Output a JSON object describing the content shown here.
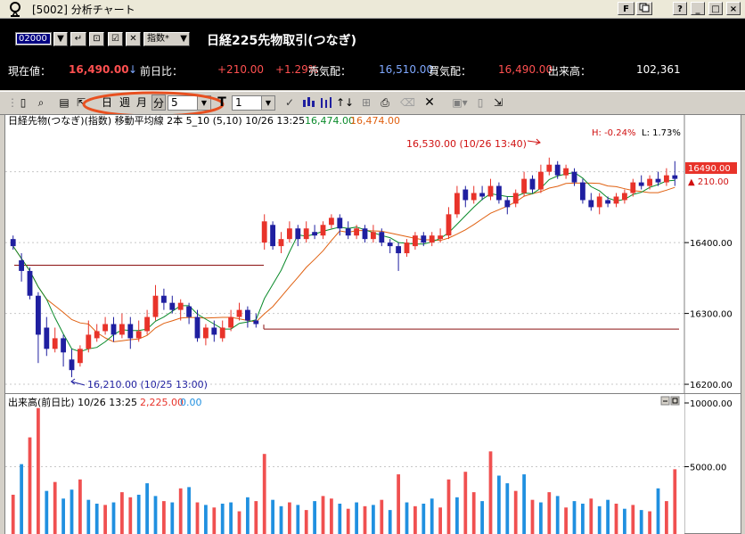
{
  "window": {
    "title": "[5002] 分析チャート",
    "buttons": [
      "F",
      "?",
      "_",
      "□",
      "×"
    ]
  },
  "header": {
    "code_value": "02000",
    "indicator_select": "指数*",
    "instrument_title": "日経225先物取引(つなぎ)",
    "current_price_label": "現在値：",
    "current_price": "16,490.00",
    "current_price_arrow": "↓",
    "prev_day_label": "前日比：",
    "change_value": "+210.00",
    "change_percent": "+1.29%",
    "ask_label": "売気配：",
    "ask_value": "16,510.00",
    "bid_label": "買気配：",
    "bid_value": "16,490.00",
    "volume_label": "出来高：",
    "volume_value": "102,361"
  },
  "toolbar": {
    "period_day": "日",
    "period_week": "週",
    "period_month": "月",
    "period_minute": "分",
    "minute_value": "5",
    "count_value": "1",
    "bold_t": "T"
  },
  "price_panel": {
    "legend_prefix": "日経先物(つなぎ)(指数) 移動平均線 2本 5_10 (5,10) 10/26 13:25 ",
    "legend_ma5": "16,474.00",
    "legend_ma10": "16,474.00",
    "high_annotation": "16,530.00 (10/26 13:40)",
    "low_annotation": "16,210.00 (10/25 13:00)",
    "h_label": "H: -0.24%",
    "l_label": "L: 1.73%",
    "last_price_tag": "16490.00",
    "change_tag": "▲ 210.00",
    "y_ticks": [
      "16400.00",
      "16300.00",
      "16200.00"
    ]
  },
  "volume_panel": {
    "legend_prefix": "出来高(前日比) 10/26 13:25 ",
    "legend_red": "2,225.00",
    "legend_blue": "0.00",
    "y_ticks": [
      "10000.00",
      "5000.00"
    ]
  },
  "chart_data": {
    "type": "candlestick",
    "ylim": [
      16190,
      16560
    ],
    "candles": [
      {
        "o": 16405,
        "c": 16395,
        "h": 16410,
        "l": 16390
      },
      {
        "o": 16375,
        "c": 16360,
        "h": 16385,
        "l": 16345
      },
      {
        "o": 16360,
        "c": 16325,
        "h": 16365,
        "l": 16320
      },
      {
        "o": 16325,
        "c": 16270,
        "h": 16330,
        "l": 16230
      },
      {
        "o": 16280,
        "c": 16250,
        "h": 16295,
        "l": 16240
      },
      {
        "o": 16250,
        "c": 16265,
        "h": 16280,
        "l": 16245
      },
      {
        "o": 16265,
        "c": 16245,
        "h": 16270,
        "l": 16225
      },
      {
        "o": 16235,
        "c": 16220,
        "h": 16250,
        "l": 16210
      },
      {
        "o": 16230,
        "c": 16250,
        "h": 16255,
        "l": 16225
      },
      {
        "o": 16250,
        "c": 16270,
        "h": 16290,
        "l": 16245
      },
      {
        "o": 16265,
        "c": 16275,
        "h": 16285,
        "l": 16260
      },
      {
        "o": 16275,
        "c": 16285,
        "h": 16295,
        "l": 16270
      },
      {
        "o": 16285,
        "c": 16270,
        "h": 16295,
        "l": 16260
      },
      {
        "o": 16270,
        "c": 16285,
        "h": 16300,
        "l": 16265
      },
      {
        "o": 16285,
        "c": 16265,
        "h": 16295,
        "l": 16250
      },
      {
        "o": 16265,
        "c": 16275,
        "h": 16290,
        "l": 16260
      },
      {
        "o": 16275,
        "c": 16295,
        "h": 16305,
        "l": 16270
      },
      {
        "o": 16295,
        "c": 16325,
        "h": 16340,
        "l": 16290
      },
      {
        "o": 16325,
        "c": 16315,
        "h": 16335,
        "l": 16305
      },
      {
        "o": 16315,
        "c": 16305,
        "h": 16325,
        "l": 16300
      },
      {
        "o": 16305,
        "c": 16315,
        "h": 16320,
        "l": 16290
      },
      {
        "o": 16310,
        "c": 16295,
        "h": 16315,
        "l": 16285
      },
      {
        "o": 16295,
        "c": 16265,
        "h": 16305,
        "l": 16260
      },
      {
        "o": 16265,
        "c": 16280,
        "h": 16285,
        "l": 16255
      },
      {
        "o": 16280,
        "c": 16270,
        "h": 16290,
        "l": 16260
      },
      {
        "o": 16265,
        "c": 16280,
        "h": 16290,
        "l": 16260
      },
      {
        "o": 16280,
        "c": 16295,
        "h": 16305,
        "l": 16275
      },
      {
        "o": 16295,
        "c": 16305,
        "h": 16315,
        "l": 16290
      },
      {
        "o": 16305,
        "c": 16290,
        "h": 16310,
        "l": 16280
      },
      {
        "o": 16290,
        "c": 16285,
        "h": 16300,
        "l": 16280
      },
      {
        "o": 16400,
        "c": 16430,
        "h": 16440,
        "l": 16390
      },
      {
        "o": 16425,
        "c": 16395,
        "h": 16430,
        "l": 16390
      },
      {
        "o": 16395,
        "c": 16405,
        "h": 16415,
        "l": 16385
      },
      {
        "o": 16405,
        "c": 16420,
        "h": 16430,
        "l": 16400
      },
      {
        "o": 16420,
        "c": 16405,
        "h": 16425,
        "l": 16395
      },
      {
        "o": 16405,
        "c": 16420,
        "h": 16430,
        "l": 16400
      },
      {
        "o": 16415,
        "c": 16410,
        "h": 16425,
        "l": 16405
      },
      {
        "o": 16410,
        "c": 16425,
        "h": 16430,
        "l": 16405
      },
      {
        "o": 16425,
        "c": 16435,
        "h": 16440,
        "l": 16420
      },
      {
        "o": 16435,
        "c": 16420,
        "h": 16440,
        "l": 16410
      },
      {
        "o": 16420,
        "c": 16410,
        "h": 16430,
        "l": 16405
      },
      {
        "o": 16410,
        "c": 16420,
        "h": 16425,
        "l": 16405
      },
      {
        "o": 16420,
        "c": 16405,
        "h": 16425,
        "l": 16400
      },
      {
        "o": 16405,
        "c": 16415,
        "h": 16425,
        "l": 16400
      },
      {
        "o": 16415,
        "c": 16400,
        "h": 16420,
        "l": 16395
      },
      {
        "o": 16400,
        "c": 16395,
        "h": 16405,
        "l": 16385
      },
      {
        "o": 16395,
        "c": 16385,
        "h": 16400,
        "l": 16360
      },
      {
        "o": 16385,
        "c": 16400,
        "h": 16405,
        "l": 16380
      },
      {
        "o": 16395,
        "c": 16410,
        "h": 16415,
        "l": 16390
      },
      {
        "o": 16410,
        "c": 16400,
        "h": 16415,
        "l": 16395
      },
      {
        "o": 16400,
        "c": 16410,
        "h": 16415,
        "l": 16395
      },
      {
        "o": 16405,
        "c": 16410,
        "h": 16420,
        "l": 16400
      },
      {
        "o": 16410,
        "c": 16440,
        "h": 16450,
        "l": 16405
      },
      {
        "o": 16440,
        "c": 16470,
        "h": 16480,
        "l": 16435
      },
      {
        "o": 16475,
        "c": 16460,
        "h": 16480,
        "l": 16450
      },
      {
        "o": 16460,
        "c": 16470,
        "h": 16480,
        "l": 16455
      },
      {
        "o": 16470,
        "c": 16465,
        "h": 16480,
        "l": 16460
      },
      {
        "o": 16465,
        "c": 16480,
        "h": 16490,
        "l": 16460
      },
      {
        "o": 16480,
        "c": 16460,
        "h": 16485,
        "l": 16455
      },
      {
        "o": 16460,
        "c": 16450,
        "h": 16465,
        "l": 16440
      },
      {
        "o": 16455,
        "c": 16470,
        "h": 16475,
        "l": 16450
      },
      {
        "o": 16470,
        "c": 16490,
        "h": 16500,
        "l": 16465
      },
      {
        "o": 16490,
        "c": 16475,
        "h": 16495,
        "l": 16470
      },
      {
        "o": 16475,
        "c": 16500,
        "h": 16510,
        "l": 16470
      },
      {
        "o": 16500,
        "c": 16510,
        "h": 16520,
        "l": 16495
      },
      {
        "o": 16510,
        "c": 16495,
        "h": 16515,
        "l": 16490
      },
      {
        "o": 16495,
        "c": 16505,
        "h": 16510,
        "l": 16490
      },
      {
        "o": 16500,
        "c": 16485,
        "h": 16505,
        "l": 16480
      },
      {
        "o": 16485,
        "c": 16460,
        "h": 16490,
        "l": 16455
      },
      {
        "o": 16460,
        "c": 16450,
        "h": 16470,
        "l": 16445
      },
      {
        "o": 16450,
        "c": 16465,
        "h": 16470,
        "l": 16440
      },
      {
        "o": 16460,
        "c": 16455,
        "h": 16465,
        "l": 16450
      },
      {
        "o": 16455,
        "c": 16465,
        "h": 16470,
        "l": 16450
      },
      {
        "o": 16460,
        "c": 16470,
        "h": 16475,
        "l": 16455
      },
      {
        "o": 16470,
        "c": 16485,
        "h": 16490,
        "l": 16465
      },
      {
        "o": 16485,
        "c": 16480,
        "h": 16495,
        "l": 16475
      },
      {
        "o": 16480,
        "c": 16490,
        "h": 16495,
        "l": 16475
      },
      {
        "o": 16490,
        "c": 16485,
        "h": 16500,
        "l": 16480
      },
      {
        "o": 16485,
        "c": 16495,
        "h": 16505,
        "l": 16480
      },
      {
        "o": 16495,
        "c": 16490,
        "h": 16515,
        "l": 16480
      }
    ],
    "hline_upper": 16368,
    "hline_lower": 16278,
    "volume_ylim": [
      0,
      10000
    ],
    "volume": [
      {
        "v": 2800,
        "d": "u"
      },
      {
        "v": 5200,
        "d": "d"
      },
      {
        "v": 7300,
        "d": "u"
      },
      {
        "v": 9600,
        "d": "u"
      },
      {
        "v": 3100,
        "d": "d"
      },
      {
        "v": 3800,
        "d": "u"
      },
      {
        "v": 2500,
        "d": "d"
      },
      {
        "v": 3200,
        "d": "d"
      },
      {
        "v": 4000,
        "d": "u"
      },
      {
        "v": 2400,
        "d": "d"
      },
      {
        "v": 2100,
        "d": "d"
      },
      {
        "v": 2000,
        "d": "u"
      },
      {
        "v": 2200,
        "d": "d"
      },
      {
        "v": 3000,
        "d": "u"
      },
      {
        "v": 2600,
        "d": "u"
      },
      {
        "v": 2800,
        "d": "d"
      },
      {
        "v": 3700,
        "d": "d"
      },
      {
        "v": 2700,
        "d": "d"
      },
      {
        "v": 2300,
        "d": "u"
      },
      {
        "v": 2200,
        "d": "d"
      },
      {
        "v": 3300,
        "d": "u"
      },
      {
        "v": 3400,
        "d": "d"
      },
      {
        "v": 2200,
        "d": "u"
      },
      {
        "v": 2000,
        "d": "d"
      },
      {
        "v": 1800,
        "d": "u"
      },
      {
        "v": 2100,
        "d": "d"
      },
      {
        "v": 2200,
        "d": "d"
      },
      {
        "v": 1500,
        "d": "u"
      },
      {
        "v": 2600,
        "d": "d"
      },
      {
        "v": 2300,
        "d": "u"
      },
      {
        "v": 6000,
        "d": "u"
      },
      {
        "v": 2400,
        "d": "d"
      },
      {
        "v": 1900,
        "d": "d"
      },
      {
        "v": 2200,
        "d": "u"
      },
      {
        "v": 2000,
        "d": "d"
      },
      {
        "v": 1600,
        "d": "u"
      },
      {
        "v": 2300,
        "d": "d"
      },
      {
        "v": 2700,
        "d": "u"
      },
      {
        "v": 2500,
        "d": "u"
      },
      {
        "v": 2100,
        "d": "d"
      },
      {
        "v": 1700,
        "d": "u"
      },
      {
        "v": 2200,
        "d": "d"
      },
      {
        "v": 1900,
        "d": "u"
      },
      {
        "v": 2000,
        "d": "d"
      },
      {
        "v": 2400,
        "d": "u"
      },
      {
        "v": 1600,
        "d": "d"
      },
      {
        "v": 4400,
        "d": "u"
      },
      {
        "v": 2200,
        "d": "d"
      },
      {
        "v": 1900,
        "d": "u"
      },
      {
        "v": 2100,
        "d": "d"
      },
      {
        "v": 2500,
        "d": "d"
      },
      {
        "v": 1800,
        "d": "u"
      },
      {
        "v": 4000,
        "d": "u"
      },
      {
        "v": 2600,
        "d": "d"
      },
      {
        "v": 4600,
        "d": "u"
      },
      {
        "v": 3000,
        "d": "u"
      },
      {
        "v": 2300,
        "d": "d"
      },
      {
        "v": 6200,
        "d": "u"
      },
      {
        "v": 4300,
        "d": "d"
      },
      {
        "v": 3700,
        "d": "d"
      },
      {
        "v": 3100,
        "d": "u"
      },
      {
        "v": 4400,
        "d": "d"
      },
      {
        "v": 2400,
        "d": "u"
      },
      {
        "v": 2200,
        "d": "d"
      },
      {
        "v": 3000,
        "d": "u"
      },
      {
        "v": 2700,
        "d": "d"
      },
      {
        "v": 1800,
        "d": "u"
      },
      {
        "v": 2300,
        "d": "d"
      },
      {
        "v": 2100,
        "d": "d"
      },
      {
        "v": 2500,
        "d": "u"
      },
      {
        "v": 1900,
        "d": "d"
      },
      {
        "v": 2400,
        "d": "d"
      },
      {
        "v": 2100,
        "d": "u"
      },
      {
        "v": 1700,
        "d": "d"
      },
      {
        "v": 2000,
        "d": "u"
      },
      {
        "v": 1600,
        "d": "d"
      },
      {
        "v": 1500,
        "d": "u"
      },
      {
        "v": 3300,
        "d": "d"
      },
      {
        "v": 2300,
        "d": "u"
      },
      {
        "v": 4800,
        "d": "u"
      }
    ]
  },
  "colors": {
    "up": "#e8332a",
    "down": "#1f1fa0",
    "ma5": "#0a8a2a",
    "ma10": "#e06010",
    "vol_up": "#f05050",
    "vol_down": "#2090e0",
    "hline": "#8b1010",
    "highlight_oval": "#e85020"
  }
}
